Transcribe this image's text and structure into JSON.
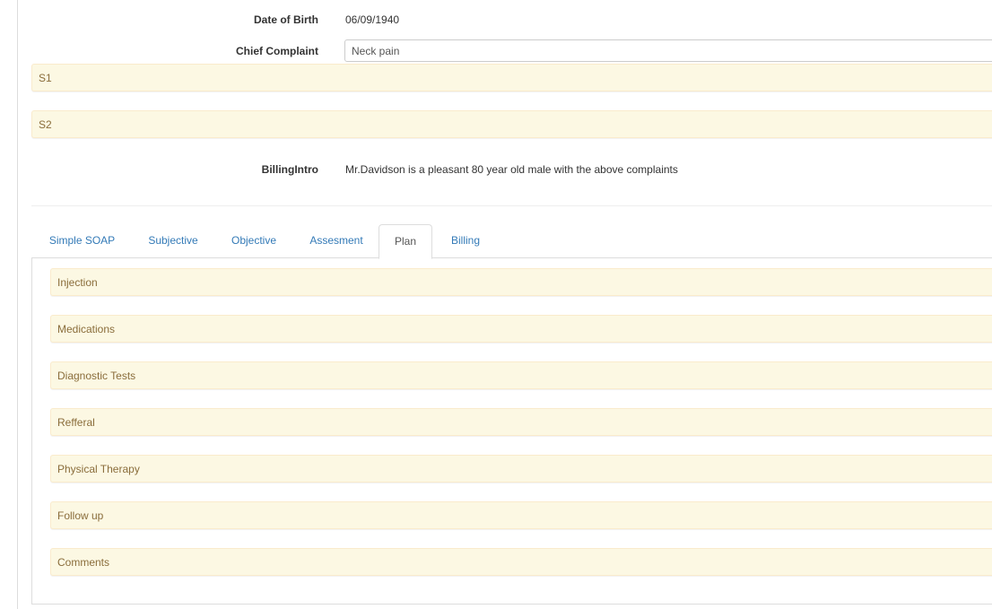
{
  "header": {
    "dob_label": "Date of Birth",
    "dob_value": "06/09/1940",
    "complaint_label": "Chief Complaint",
    "complaint_value": "Neck pain"
  },
  "sections": {
    "s1": "S1",
    "s2": "S2"
  },
  "billing_intro": {
    "label": "BillingIntro",
    "text": "Mr.Davidson is a pleasant 80 year old male with the above complaints"
  },
  "tabs": [
    {
      "label": "Simple SOAP",
      "active": false
    },
    {
      "label": "Subjective",
      "active": false
    },
    {
      "label": "Objective",
      "active": false
    },
    {
      "label": "Assesment",
      "active": false
    },
    {
      "label": "Plan",
      "active": true
    },
    {
      "label": "Billing",
      "active": false
    }
  ],
  "plan_panels": [
    {
      "title": "Injection"
    },
    {
      "title": "Medications"
    },
    {
      "title": "Diagnostic Tests"
    },
    {
      "title": "Refferal"
    },
    {
      "title": "Physical Therapy"
    },
    {
      "title": "Follow up"
    },
    {
      "title": "Comments"
    }
  ],
  "colors": {
    "panel_bg": "#fcf8e3",
    "panel_border": "#faebcc",
    "panel_text": "#8a6d3b",
    "tab_link": "#337ab7"
  }
}
